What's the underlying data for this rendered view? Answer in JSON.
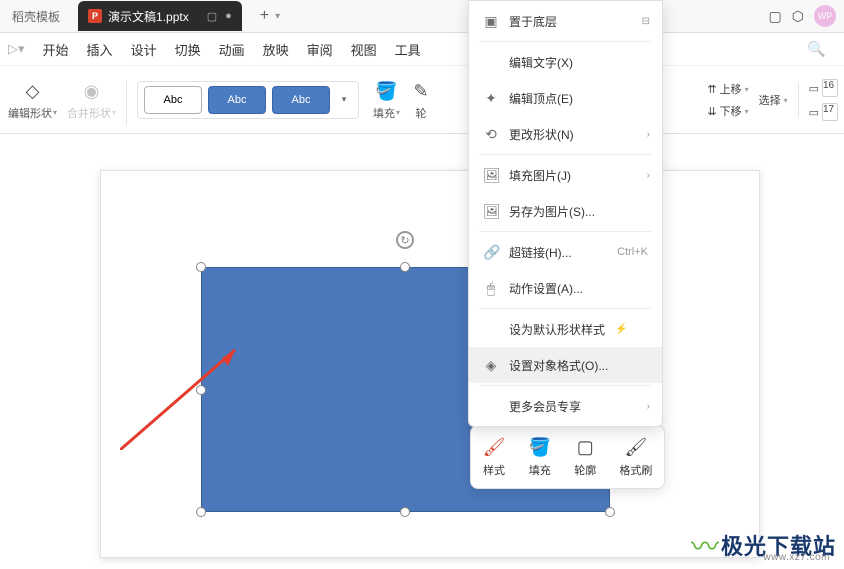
{
  "titlebar": {
    "inactive_tab": "稻壳模板",
    "file_icon": "P",
    "active_tab": "演示文稿1.pptx",
    "avatar": "WP"
  },
  "menurow": {
    "items": [
      "开始",
      "插入",
      "设计",
      "切换",
      "动画",
      "放映",
      "审阅",
      "视图",
      "工具"
    ]
  },
  "toolbar": {
    "edit_shape": "编辑形状",
    "merge_shape": "合并形状",
    "preset": "Abc",
    "fill": "填充",
    "outline": "轮"
  },
  "right_tools": {
    "move_up": "上移",
    "move_down": "下移",
    "select": "选择",
    "val1": "16",
    "val2": "17"
  },
  "context_menu": {
    "send_back": "置于底层",
    "edit_text": "编辑文字(X)",
    "edit_vertex": "编辑顶点(E)",
    "change_shape": "更改形状(N)",
    "fill_image": "填充图片(J)",
    "save_as_image": "另存为图片(S)...",
    "hyperlink": "超链接(H)...",
    "hyperlink_shortcut": "Ctrl+K",
    "action_settings": "动作设置(A)...",
    "default_style": "设为默认形状样式",
    "format_object": "设置对象格式(O)...",
    "vip_more": "更多会员专享"
  },
  "mini_toolbar": {
    "style": "样式",
    "fill": "填充",
    "outline": "轮廓",
    "format_painter": "格式刷"
  },
  "watermark": {
    "text": "极光下载站",
    "url": "www.xz7.com"
  }
}
